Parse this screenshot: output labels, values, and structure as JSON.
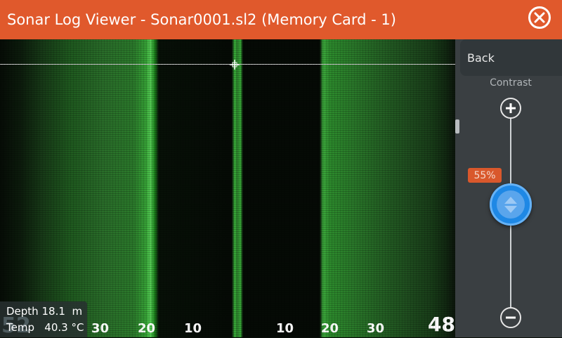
{
  "window": {
    "title": "Sonar Log Viewer - Sonar0001.sl2 (Memory Card - 1)"
  },
  "sonar_view": {
    "scale_labels": [
      "30",
      "20",
      "10",
      "10",
      "20",
      "30"
    ],
    "range": "48",
    "depth_overlay": "52"
  },
  "info": {
    "depth_label": "Depth",
    "depth_value": "18.1",
    "depth_unit": "m",
    "temp_label": "Temp",
    "temp_value": "40.3",
    "temp_unit": "°C"
  },
  "side_panel": {
    "back_label": "Back",
    "contrast_label": "Contrast",
    "contrast_value": 0.55,
    "contrast_text": "55%"
  },
  "colors": {
    "title_bar": "#e0592c",
    "knob": "#1e88e5",
    "badge": "#d9582c",
    "sonar_green": "#36a236"
  }
}
